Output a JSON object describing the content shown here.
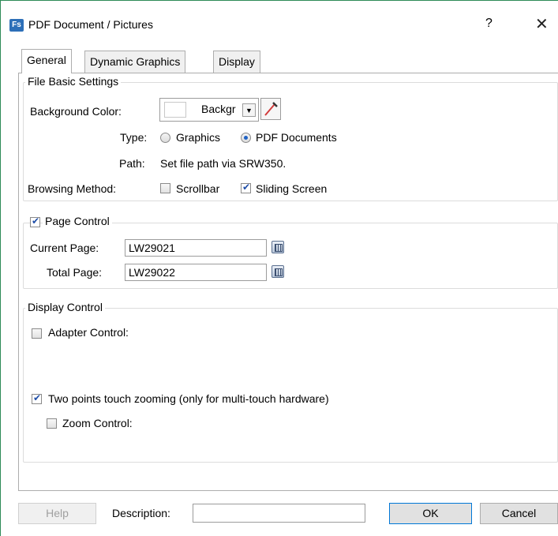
{
  "window": {
    "app_icon_text": "Fs",
    "title": "PDF Document / Pictures",
    "help_glyph": "?",
    "close_glyph": "✕"
  },
  "tabs": [
    {
      "label": "General",
      "active": true
    },
    {
      "label": "Dynamic Graphics",
      "active": false
    },
    {
      "label": "Display",
      "active": false
    }
  ],
  "file_basic": {
    "title": "File Basic Settings",
    "background_color_label": "Background Color:",
    "background_color_value": "Backgr",
    "background_color_swatch": "#ffffff",
    "type_label": "Type:",
    "type_options": [
      {
        "label": "Graphics",
        "selected": false
      },
      {
        "label": "PDF Documents",
        "selected": true
      }
    ],
    "path_label": "Path:",
    "path_value": "Set file path via SRW350.",
    "browsing_label": "Browsing Method:",
    "browsing_options": [
      {
        "label": "Scrollbar",
        "checked": false
      },
      {
        "label": "Sliding Screen",
        "checked": true
      }
    ]
  },
  "page_control": {
    "title": "Page Control",
    "checked": true,
    "current_page_label": "Current Page:",
    "current_page_value": "LW29021",
    "total_page_label": "Total Page:",
    "total_page_value": "LW29022"
  },
  "display_control": {
    "title": "Display Control",
    "adapter_label": "Adapter Control:",
    "adapter_checked": false,
    "two_points_label": "Two points touch zooming (only for multi-touch hardware)",
    "two_points_checked": true,
    "zoom_label": "Zoom Control:",
    "zoom_checked": false
  },
  "footer": {
    "help_label": "Help",
    "description_label": "Description:",
    "description_value": "",
    "ok_label": "OK",
    "cancel_label": "Cancel"
  },
  "colors": {
    "window_border": "#2e8b57",
    "accent": "#0078d7",
    "icon_blue": "#2d6fb8"
  }
}
